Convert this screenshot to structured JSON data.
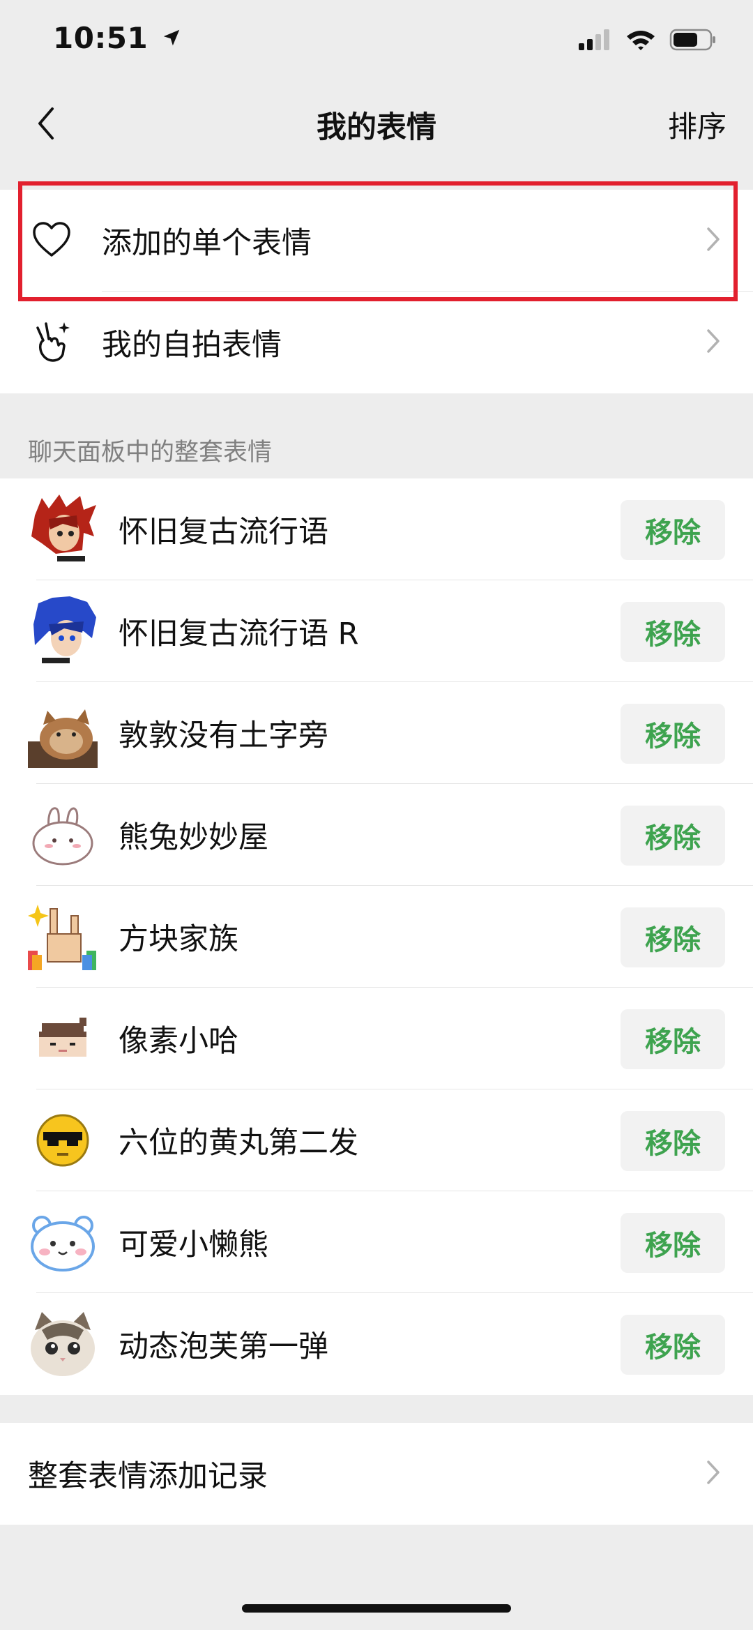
{
  "status_bar": {
    "time": "10:51"
  },
  "nav": {
    "title": "我的表情",
    "right_action": "排序"
  },
  "top_items": [
    {
      "label": "添加的单个表情",
      "icon": "heart-icon"
    },
    {
      "label": "我的自拍表情",
      "icon": "selfie-hand-icon"
    }
  ],
  "section": {
    "header": "聊天面板中的整套表情"
  },
  "packs": [
    {
      "name": "怀旧复古流行语",
      "remove": "移除",
      "thumb": "red-hair-anime-avatar"
    },
    {
      "name": "怀旧复古流行语 R",
      "remove": "移除",
      "thumb": "blue-hair-anime-avatar"
    },
    {
      "name": "敦敦没有土字旁",
      "remove": "移除",
      "thumb": "brown-cat-photo"
    },
    {
      "name": "熊兔妙妙屋",
      "remove": "移除",
      "thumb": "white-bunny"
    },
    {
      "name": "方块家族",
      "remove": "移除",
      "thumb": "pixel-rock-hand"
    },
    {
      "name": "像素小哈",
      "remove": "移除",
      "thumb": "pixel-girl-face"
    },
    {
      "name": "六位的黄丸第二发",
      "remove": "移除",
      "thumb": "pixel-yellow-face-sunglasses"
    },
    {
      "name": "可爱小懒熊",
      "remove": "移除",
      "thumb": "blue-bear-face"
    },
    {
      "name": "动态泡芙第一弹",
      "remove": "移除",
      "thumb": "tabby-cat-face"
    }
  ],
  "footer_item": {
    "label": "整套表情添加记录"
  },
  "colors": {
    "accent_green": "#3ea34f",
    "highlight_red": "#e2202e",
    "background": "#ededed"
  }
}
